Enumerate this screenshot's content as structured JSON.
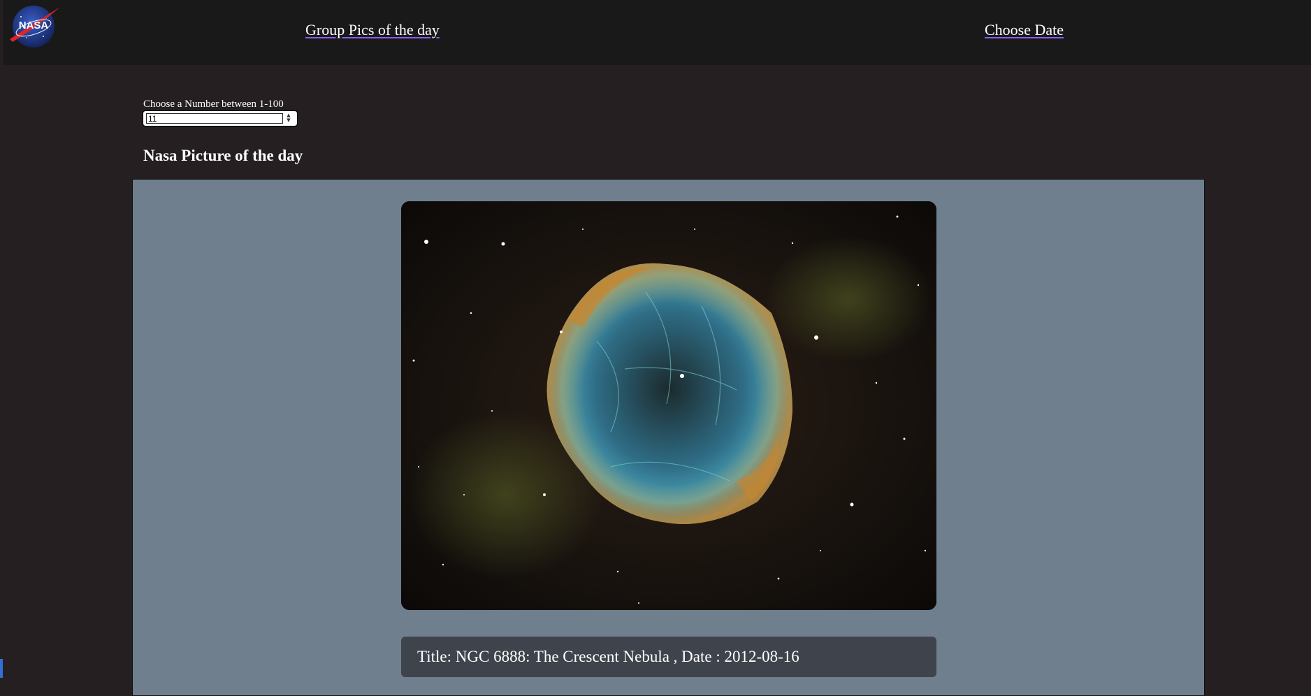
{
  "nav": {
    "logo_text": "NASA",
    "links": [
      {
        "label": "Group Pics of the day"
      },
      {
        "label": "Choose Date"
      }
    ]
  },
  "picker": {
    "label": "Choose a Number between 1-100",
    "value": "11"
  },
  "main": {
    "heading": "Nasa Picture of the day",
    "caption": "Title: NGC 6888: The Crescent Nebula , Date : 2012-08-16",
    "image_alt": "crescent-nebula-photo"
  },
  "colors": {
    "page_bg": "#251f21",
    "navbar_bg": "#191919",
    "card_bg": "#6f7f8e",
    "caption_bg": "#3f434c",
    "link_underline": "#8a5cf5"
  }
}
